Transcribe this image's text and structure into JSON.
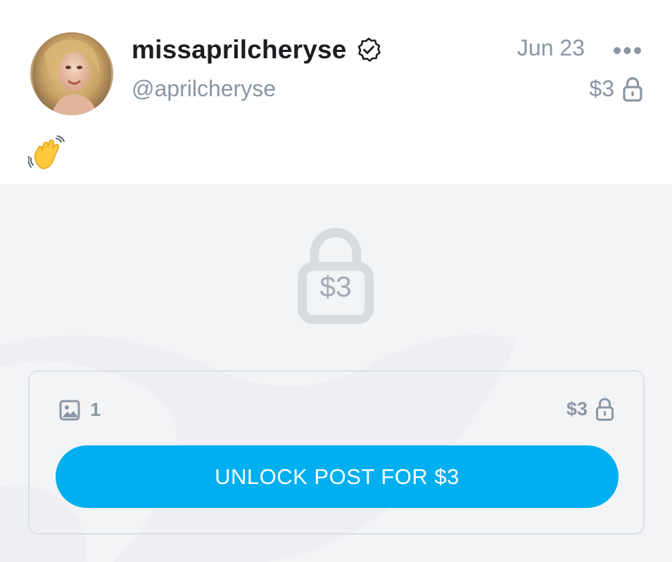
{
  "post": {
    "display_name": "missaprilcheryse",
    "handle": "@aprilcheryse",
    "date": "Jun 23",
    "price": "$3",
    "text": "👋"
  },
  "icons": {
    "avatar": "avatar",
    "verified": "verified-badge-icon",
    "more": "more-options-icon",
    "lock": "lock-icon",
    "image": "image-icon"
  },
  "locked_media": {
    "lock_price": "$3",
    "media_count": "1",
    "card_price": "$3",
    "unlock_label": "UNLOCK POST FOR $3"
  },
  "colors": {
    "accent": "#00aff0",
    "muted_text": "#8a96a3",
    "locked_bg": "#f3f4f6"
  }
}
